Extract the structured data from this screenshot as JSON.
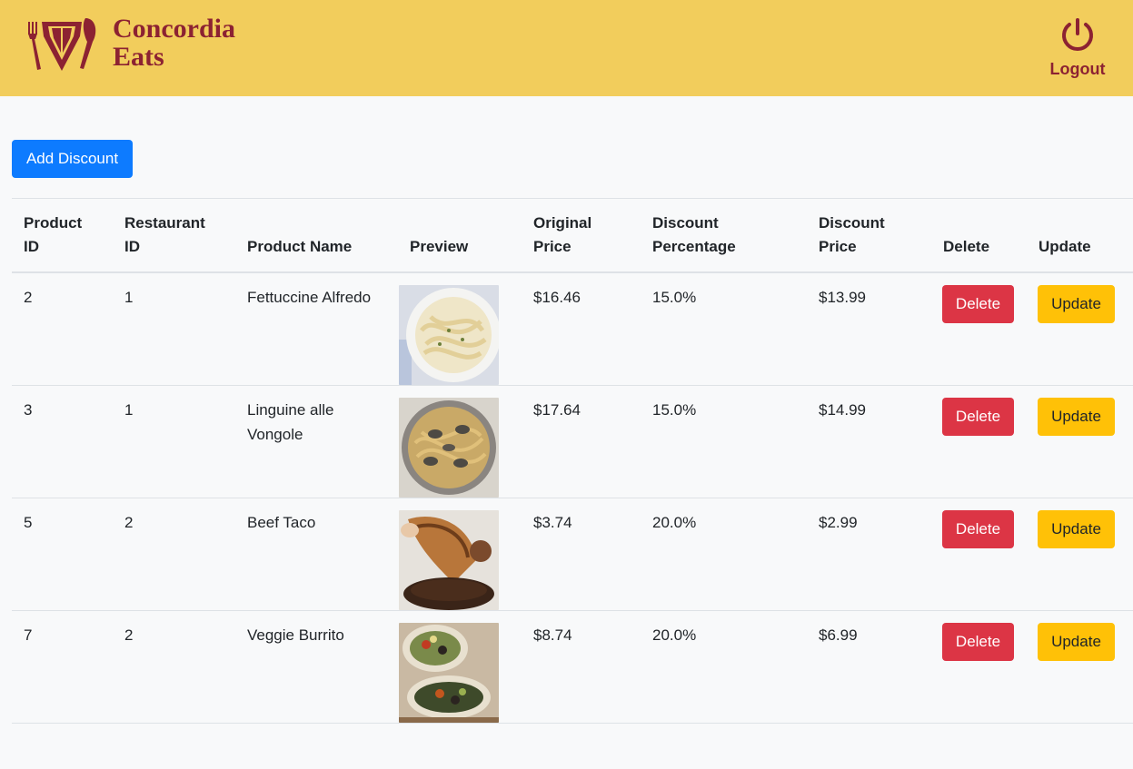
{
  "header": {
    "brand_line1": "Concordia",
    "brand_line2": "Eats",
    "logout_label": "Logout",
    "brand_color": "#8c2232",
    "bar_color": "#f2cd5c"
  },
  "toolbar": {
    "add_discount_label": "Add Discount"
  },
  "table": {
    "headers": {
      "product_id": [
        "Product",
        "ID"
      ],
      "restaurant_id": [
        "Restaurant",
        "ID"
      ],
      "product_name": "Product Name",
      "preview": "Preview",
      "original_price": [
        "Original",
        "Price"
      ],
      "discount_percentage": [
        "Discount",
        "Percentage"
      ],
      "discount_price": [
        "Discount",
        "Price"
      ],
      "delete": "Delete",
      "update": "Update"
    },
    "rows": [
      {
        "product_id": "2",
        "restaurant_id": "1",
        "product_name": "Fettuccine Alfredo",
        "preview": "fettuccine-alfredo-photo",
        "original_price": "$16.46",
        "discount_percentage": "15.0%",
        "discount_price": "$13.99",
        "delete_label": "Delete",
        "update_label": "Update"
      },
      {
        "product_id": "3",
        "restaurant_id": "1",
        "product_name": "Linguine alle Vongole",
        "preview": "linguine-vongole-photo",
        "original_price": "$17.64",
        "discount_percentage": "15.0%",
        "discount_price": "$14.99",
        "delete_label": "Delete",
        "update_label": "Update"
      },
      {
        "product_id": "5",
        "restaurant_id": "2",
        "product_name": "Beef Taco",
        "preview": "beef-taco-photo",
        "original_price": "$3.74",
        "discount_percentage": "20.0%",
        "discount_price": "$2.99",
        "delete_label": "Delete",
        "update_label": "Update"
      },
      {
        "product_id": "7",
        "restaurant_id": "2",
        "product_name": "Veggie Burrito",
        "preview": "veggie-burrito-photo",
        "original_price": "$8.74",
        "discount_percentage": "20.0%",
        "discount_price": "$6.99",
        "delete_label": "Delete",
        "update_label": "Update"
      }
    ]
  },
  "colors": {
    "primary": "#0d7bff",
    "danger": "#dc3545",
    "warning": "#ffc107"
  }
}
